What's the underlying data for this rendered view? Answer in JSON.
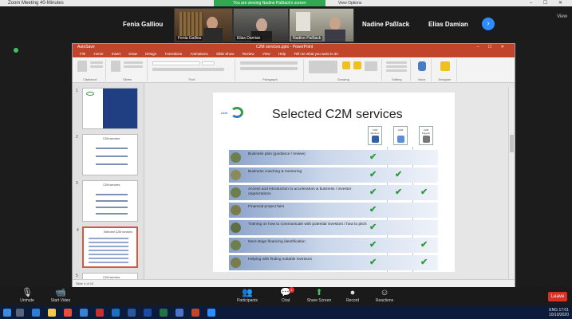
{
  "window": {
    "title": "Zoom Meeting 40-Minutes",
    "share_banner": "You are viewing Nadine Paßlack's screen",
    "share_options": "View Options",
    "controls": "– ☐ ✕"
  },
  "participants": [
    {
      "name": "Fenia Galliou"
    },
    {
      "name": "Fenia Galliou",
      "video_caption": "Fenia Galliou"
    },
    {
      "name": "Elias Damian",
      "video_caption": "Elias Damian"
    },
    {
      "name": "Nadine Paßlack",
      "video_caption": "Nadine Paßlack"
    },
    {
      "name": "Nadine Paßlack"
    },
    {
      "name": "Elias Damian"
    }
  ],
  "view_label": "View",
  "next_icon": "chevron-right-icon",
  "powerpoint": {
    "file_name": "AutoSave",
    "doc_title": "C2M services.pptx - PowerPoint",
    "title_controls": "– ☐ ✕",
    "tabs": [
      "File",
      "Home",
      "Insert",
      "Draw",
      "Design",
      "Transitions",
      "Animations",
      "Slide Show",
      "Review",
      "View",
      "Help",
      "Tell me what you want to do"
    ],
    "ribbon_groups": [
      "Clipboard",
      "Slides",
      "Font",
      "Paragraph",
      "Drawing",
      "Editing",
      "Voice",
      "Designer"
    ],
    "status_text": "Slide 4 of 10",
    "thumbnails": [
      {
        "num": "1",
        "title": ""
      },
      {
        "num": "2",
        "title": "C2M services"
      },
      {
        "num": "3",
        "title": "C2M services"
      },
      {
        "num": "4",
        "title": "Selected C2M services"
      },
      {
        "num": "5",
        "title": "C2M services"
      }
    ]
  },
  "slide": {
    "title": "Selected C2M services",
    "logo_text": "c2m",
    "columns": [
      {
        "label": "C2M Mentors",
        "color": "#2e5fa8"
      },
      {
        "label": "C2M",
        "color": "#5a8fd8"
      },
      {
        "label": "C2M Support",
        "color": "#777777"
      }
    ],
    "rows": [
      {
        "text": "Business plan (guidance / review)",
        "checks": [
          true,
          false,
          false
        ]
      },
      {
        "text": "Business coaching & mentoring",
        "checks": [
          true,
          true,
          false
        ]
      },
      {
        "text": "Access and introduction to accelerators & business / investor organizations",
        "checks": [
          true,
          true,
          true
        ]
      },
      {
        "text": "Financial project fairs",
        "checks": [
          true,
          false,
          false
        ]
      },
      {
        "text": "Training on how to communicate with potential investors / how to pitch",
        "checks": [
          true,
          false,
          false
        ]
      },
      {
        "text": "Next-stage financing identification",
        "checks": [
          true,
          false,
          true
        ]
      },
      {
        "text": "Helping with finding suitable investors",
        "checks": [
          true,
          false,
          true
        ]
      }
    ],
    "check_glyph": "✔"
  },
  "zoom_controls": [
    {
      "label": "Unmute",
      "glyph": "🎙",
      "icon": "microphone-icon"
    },
    {
      "label": "Start Video",
      "glyph": "📹",
      "icon": "video-camera-icon"
    },
    {
      "label": "Participants",
      "glyph": "👥",
      "icon": "participants-icon"
    },
    {
      "label": "Chat",
      "glyph": "💬",
      "icon": "chat-icon"
    },
    {
      "label": "Share Screen",
      "glyph": "⬆",
      "icon": "share-screen-icon"
    },
    {
      "label": "Record",
      "glyph": "●",
      "icon": "record-icon"
    },
    {
      "label": "Reactions",
      "glyph": "☺",
      "icon": "reactions-icon"
    }
  ],
  "chat_badge": "1",
  "leave_label": "Leave",
  "taskbar": {
    "time": "17:01",
    "date": "10/10/2020",
    "lang": "ENG"
  }
}
